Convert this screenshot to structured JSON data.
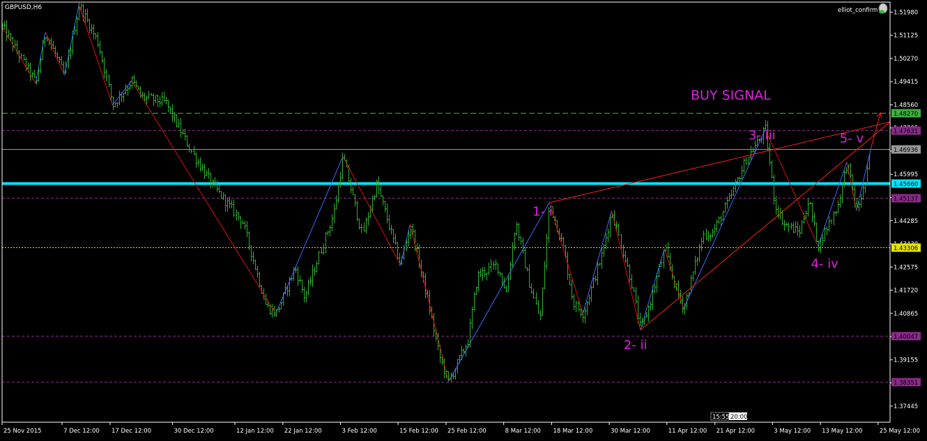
{
  "symbol_label": "GBPUSD,H6",
  "indicator_label": "elliot_confirm",
  "buy_signal": "BUY SIGNAL",
  "time_box": {
    "left": "15:55",
    "right": "20:00"
  },
  "colors": {
    "background": "#000000",
    "bar_up": "#2db52d",
    "bar_down": "#2db52d",
    "zigzag_up": "#3a6bff",
    "zigzag_down": "#e01010",
    "trendline": "#ff2020",
    "support_cyan": "#00e5ff",
    "level_green_dash": "#3cb03c",
    "level_magenta_dash": "#8a2a8a",
    "level_yellow_dot": "#e6e600",
    "level_gray": "#9a9a9a",
    "axis": "#ffffff",
    "wave_label": "#e020e0"
  },
  "chart_data": {
    "type": "candlestick",
    "title": "GBPUSD,H6",
    "ylim": [
      1.3685,
      1.5235
    ],
    "y_ticks": [
      "1.51980",
      "1.51125",
      "1.50270",
      "1.49415",
      "1.48560",
      "1.47705",
      "1.46850",
      "1.45995",
      "1.45140",
      "1.44285",
      "1.43430",
      "1.42575",
      "1.41720",
      "1.40865",
      "1.40010",
      "1.39155",
      "1.38300",
      "1.37445"
    ],
    "x_ticks": [
      "25 Nov 2015",
      "7 Dec 12:00",
      "17 Dec 12:00",
      "30 Dec 12:00",
      "12 Jan 12:00",
      "22 Jan 12:00",
      "3 Feb 12:00",
      "15 Feb 12:00",
      "25 Feb 12:00",
      "8 Mar 12:00",
      "18 Mar 12:00",
      "30 Mar 12:00",
      "11 Apr 12:00",
      "21 Apr 12:00",
      "3 May 12:00",
      "13 May 12:00",
      "25 May 12:00"
    ],
    "price_levels": [
      {
        "label": "1.48270",
        "value": 1.4827,
        "style": "green-dash",
        "tag_bg": "#3cb03c",
        "tag_fg": "#000000"
      },
      {
        "label": "1.47631",
        "value": 1.47631,
        "style": "magenta-dash",
        "tag_bg": "#8a2a8a",
        "tag_fg": "#000000"
      },
      {
        "label": "1.46936",
        "value": 1.46936,
        "style": "gray-solid",
        "tag_bg": "#9a9a9a",
        "tag_fg": "#000000"
      },
      {
        "label": "1.45660",
        "value": 1.4566,
        "style": "cyan-thick",
        "tag_bg": "#00e5ff",
        "tag_fg": "#000000"
      },
      {
        "label": "1.45137",
        "value": 1.45137,
        "style": "magenta-dash",
        "tag_bg": "#8a2a8a",
        "tag_fg": "#000000"
      },
      {
        "label": "1.43306",
        "value": 1.43306,
        "style": "yellow-dot",
        "tag_bg": "#e6e600",
        "tag_fg": "#000000"
      },
      {
        "label": "1.40047",
        "value": 1.40047,
        "style": "magenta-dash",
        "tag_bg": "#8a2a8a",
        "tag_fg": "#000000"
      },
      {
        "label": "1.38351",
        "value": 1.38351,
        "style": "magenta-dash",
        "tag_bg": "#8a2a8a",
        "tag_fg": "#000000"
      }
    ],
    "swing_points": [
      {
        "date": "25 Nov 2015",
        "price": 1.5145
      },
      {
        "date": "2 Dec 2015",
        "price": 1.4935
      },
      {
        "date": "4 Dec 2015",
        "price": 1.5125
      },
      {
        "date": "8 Dec 2015",
        "price": 1.4965
      },
      {
        "date": "11 Dec 2015",
        "price": 1.5225
      },
      {
        "date": "15 Dec 2015",
        "price": 1.5085
      },
      {
        "date": "18 Dec 2015",
        "price": 1.4855
      },
      {
        "date": "22 Dec 2015",
        "price": 1.4945
      },
      {
        "date": "24 Dec 2015",
        "price": 1.4885
      },
      {
        "date": "29 Dec 2015",
        "price": 1.4865
      },
      {
        "date": "4 Jan 2016",
        "price": 1.4665
      },
      {
        "date": "8 Jan 2016",
        "price": 1.4555
      },
      {
        "date": "14 Jan 2016",
        "price": 1.4425
      },
      {
        "date": "19 Jan 2016",
        "price": 1.4115
      },
      {
        "date": "21 Jan 2016",
        "price": 1.4085
      },
      {
        "date": "25 Jan 2016",
        "price": 1.4255
      },
      {
        "date": "27 Jan 2016",
        "price": 1.4145
      },
      {
        "date": "2 Feb 2016",
        "price": 1.4455
      },
      {
        "date": "4 Feb 2016",
        "price": 1.4665
      },
      {
        "date": "8 Feb 2016",
        "price": 1.4375
      },
      {
        "date": "11 Feb 2016",
        "price": 1.4565
      },
      {
        "date": "16 Feb 2016",
        "price": 1.4265
      },
      {
        "date": "18 Feb 2016",
        "price": 1.4415
      },
      {
        "date": "22 Feb 2016",
        "price": 1.4105
      },
      {
        "date": "24 Feb 2016",
        "price": 1.3935
      },
      {
        "date": "26 Feb 2016",
        "price": 1.3835
      },
      {
        "date": "1 Mar 2016",
        "price": 1.3985
      },
      {
        "date": "3 Mar 2016",
        "price": 1.4225
      },
      {
        "date": "7 Mar 2016",
        "price": 1.4265
      },
      {
        "date": "9 Mar 2016",
        "price": 1.4165
      },
      {
        "date": "11 Mar 2016",
        "price": 1.4425
      },
      {
        "date": "14 Mar 2016",
        "price": 1.4185
      },
      {
        "date": "16 Mar 2016",
        "price": 1.4065
      },
      {
        "date": "18 Mar 2016",
        "price": 1.4495
      },
      {
        "date": "21 Mar 2016",
        "price": 1.4325
      },
      {
        "date": "23 Mar 2016",
        "price": 1.4125
      },
      {
        "date": "25 Mar 2016",
        "price": 1.4085
      },
      {
        "date": "29 Mar 2016",
        "price": 1.4305
      },
      {
        "date": "31 Mar 2016",
        "price": 1.4465
      },
      {
        "date": "4 Apr 2016",
        "price": 1.4205
      },
      {
        "date": "6 Apr 2016",
        "price": 1.4025
      },
      {
        "date": "8 Apr 2016",
        "price": 1.4125
      },
      {
        "date": "11 Apr 2016",
        "price": 1.4325
      },
      {
        "date": "13 Apr 2016",
        "price": 1.4195
      },
      {
        "date": "15 Apr 2016",
        "price": 1.4105
      },
      {
        "date": "19 Apr 2016",
        "price": 1.4375
      },
      {
        "date": "21 Apr 2016",
        "price": 1.4385
      },
      {
        "date": "25 Apr 2016",
        "price": 1.4525
      },
      {
        "date": "28 Apr 2016",
        "price": 1.4655
      },
      {
        "date": "2 May 2016",
        "price": 1.4765
      },
      {
        "date": "4 May 2016",
        "price": 1.4485
      },
      {
        "date": "6 May 2016",
        "price": 1.4415
      },
      {
        "date": "9 May 2016",
        "price": 1.4385
      },
      {
        "date": "11 May 2016",
        "price": 1.4505
      },
      {
        "date": "13 May 2016",
        "price": 1.4335
      },
      {
        "date": "17 May 2016",
        "price": 1.4485
      },
      {
        "date": "19 May 2016",
        "price": 1.4645
      },
      {
        "date": "21 May 2016",
        "price": 1.4465
      },
      {
        "date": "23 May 2016",
        "price": 1.4575
      },
      {
        "date": "24 May 2016",
        "price": 1.4695
      }
    ],
    "zigzag": [
      {
        "date": "25 Nov 2015",
        "price": 1.5145,
        "dir": "down"
      },
      {
        "date": "2 Dec 2015",
        "price": 1.4935,
        "dir": "up"
      },
      {
        "date": "4 Dec 2015",
        "price": 1.5125,
        "dir": "down"
      },
      {
        "date": "8 Dec 2015",
        "price": 1.4965,
        "dir": "up"
      },
      {
        "date": "11 Dec 2015",
        "price": 1.5225,
        "dir": "down"
      },
      {
        "date": "18 Dec 2015",
        "price": 1.4855,
        "dir": "up"
      },
      {
        "date": "22 Dec 2015",
        "price": 1.4945,
        "dir": "down"
      },
      {
        "date": "21 Jan 2016",
        "price": 1.4085,
        "dir": "up"
      },
      {
        "date": "4 Feb 2016",
        "price": 1.4665,
        "dir": "down"
      },
      {
        "date": "16 Feb 2016",
        "price": 1.4265,
        "dir": "up"
      },
      {
        "date": "18 Feb 2016",
        "price": 1.4415,
        "dir": "down"
      },
      {
        "date": "26 Feb 2016",
        "price": 1.3835,
        "dir": "up"
      },
      {
        "date": "18 Mar 2016",
        "price": 1.4495,
        "dir": "down"
      },
      {
        "date": "25 Mar 2016",
        "price": 1.4085,
        "dir": "up"
      },
      {
        "date": "31 Mar 2016",
        "price": 1.4465,
        "dir": "down"
      },
      {
        "date": "6 Apr 2016",
        "price": 1.4025,
        "dir": "up"
      },
      {
        "date": "11 Apr 2016",
        "price": 1.4325,
        "dir": "down"
      },
      {
        "date": "15 Apr 2016",
        "price": 1.4105,
        "dir": "up"
      },
      {
        "date": "2 May 2016",
        "price": 1.4765,
        "dir": "down"
      },
      {
        "date": "13 May 2016",
        "price": 1.4335,
        "dir": "up"
      },
      {
        "date": "19 May 2016",
        "price": 1.4645,
        "dir": "down"
      },
      {
        "date": "21 May 2016",
        "price": 1.4465,
        "dir": "up"
      },
      {
        "date": "24 May 2016",
        "price": 1.4695,
        "dir": "up"
      }
    ],
    "trendlines": [
      {
        "from": {
          "date": "18 Mar 2016",
          "price": 1.4495
        },
        "to": {
          "date": "end",
          "price": 1.4793
        }
      },
      {
        "from": {
          "date": "6 Apr 2016",
          "price": 1.4025
        },
        "to": {
          "date": "end",
          "price": 1.4793
        }
      }
    ],
    "arrow": {
      "from": {
        "date": "24 May 2016",
        "price": 1.4695
      },
      "to": {
        "date": "26 May 2016",
        "price": 1.4827
      }
    },
    "wave_labels": [
      {
        "text": "1- i",
        "date": "18 Mar 2016",
        "price": 1.4447
      },
      {
        "text": "2- ii",
        "date": "6 Apr 2016",
        "price": 1.3955
      },
      {
        "text": "3- iii",
        "date": "2 May 2016",
        "price": 1.4728
      },
      {
        "text": "4- iv",
        "date": "15 May 2016",
        "price": 1.4254
      },
      {
        "text": "5- v",
        "date": "21 May 2016",
        "price": 1.4717
      }
    ]
  }
}
